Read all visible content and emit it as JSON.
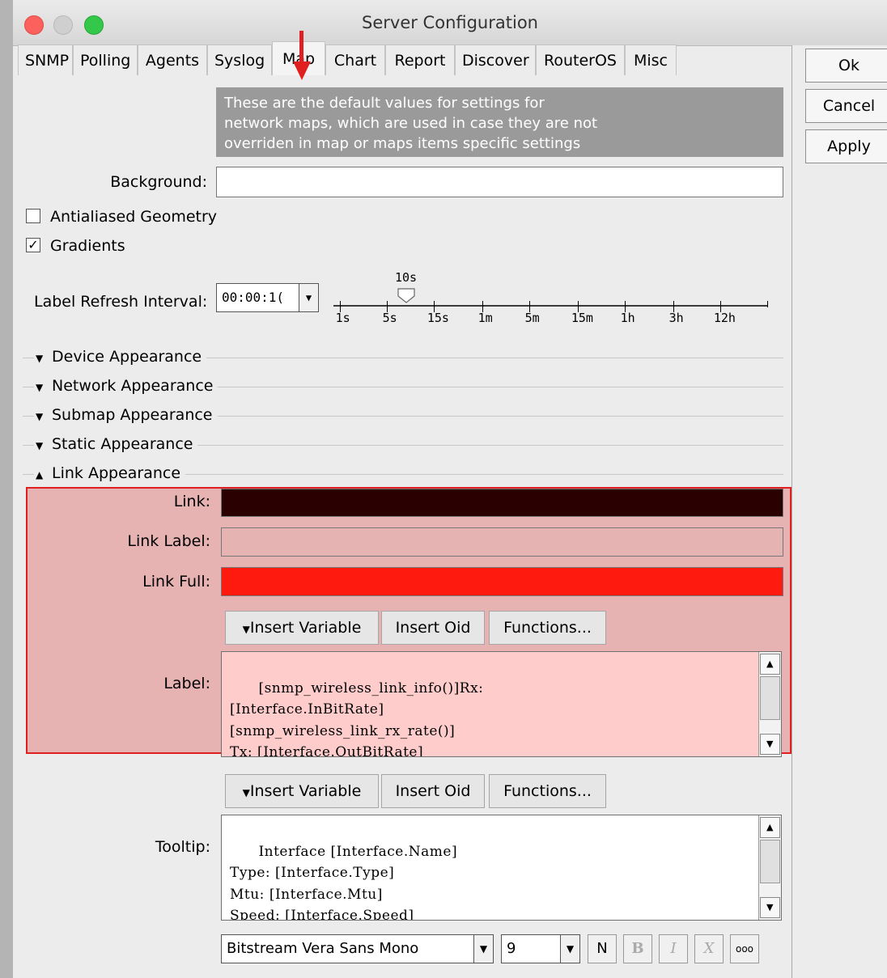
{
  "window": {
    "title": "Server Configuration"
  },
  "tabs": [
    "SNMP",
    "Polling",
    "Agents",
    "Syslog",
    "Map",
    "Chart",
    "Report",
    "Discover",
    "RouterOS",
    "Misc"
  ],
  "active_tab": "Map",
  "buttons": {
    "ok": "Ok",
    "cancel": "Cancel",
    "apply": "Apply"
  },
  "info_text": "These are the default values for settings for\nnetwork maps, which are used in case they are not\noverriden in map or maps items specific settings",
  "background": {
    "label": "Background:",
    "value": "",
    "color": "#ffffff"
  },
  "antialiased": {
    "label": "Antialiased Geometry",
    "checked": false
  },
  "gradients": {
    "label": "Gradients",
    "checked": true,
    "mark": "✓"
  },
  "refresh": {
    "label": "Label Refresh Interval:",
    "value": "00:00:1(",
    "current": "10s",
    "ticks": [
      "1s",
      "5s",
      "15s",
      "1m",
      "5m",
      "15m",
      "1h",
      "3h",
      "12h"
    ]
  },
  "sections": {
    "device": "Device Appearance",
    "network": "Network Appearance",
    "submap": "Submap Appearance",
    "static": "Static Appearance",
    "link": "Link Appearance"
  },
  "link": {
    "link_label": "Link:",
    "link_color": "#2b0000",
    "linklabel_label": "Link Label:",
    "linklabel_color": "#e6b3b3",
    "linkfull_label": "Link Full:",
    "linkfull_color": "#ff1a10",
    "label_label": "Label:",
    "label_text": "[snmp_wireless_link_info()]Rx:\n[Interface.InBitRate]\n[snmp_wireless_link_rx_rate()]\nTx: [Interface.OutBitRate]"
  },
  "toolbar": {
    "insert_variable": "Insert Variable",
    "insert_oid": "Insert Oid",
    "functions": "Functions..."
  },
  "tooltip": {
    "label": "Tooltip:",
    "text": "Interface [Interface.Name]\nType: [Interface.Type]\nMtu: [Interface.Mtu]\nSpeed: [Interface.Speed]"
  },
  "font": {
    "family": "Bitstream Vera Sans Mono",
    "size": "9"
  },
  "format_buttons": [
    "N",
    "B",
    "I",
    "X",
    "ooo"
  ],
  "highlight_color": "#e02020"
}
